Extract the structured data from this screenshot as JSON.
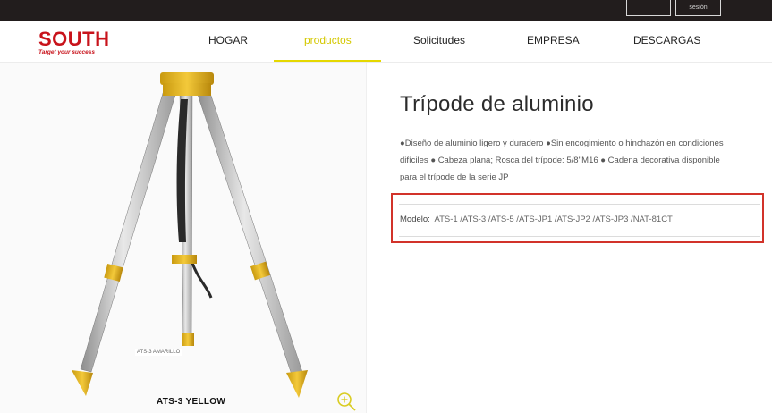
{
  "header": {
    "account_label": "sesión"
  },
  "logo": {
    "brand": "SOUTH",
    "tagline": "Target your success"
  },
  "nav": {
    "items": [
      {
        "label": "HOGAR"
      },
      {
        "label": "productos"
      },
      {
        "label": "Solicitudes"
      },
      {
        "label": "EMPRESA"
      },
      {
        "label": "DESCARGAS"
      }
    ],
    "active_index": 1,
    "accent_color": "#e5d800"
  },
  "product": {
    "title": "Trípode de aluminio",
    "description": "●Diseño de aluminio ligero y duradero ●Sin encogimiento o hinchazón en condiciones difíciles ● Cabeza plana; Rosca del trípode: 5/8''M16 ● Cadena decorativa disponible para el trípode de la serie JP",
    "model_label": "Modelo:",
    "model_value": "ATS-1 /ATS-3 /ATS-5 /ATS-JP1 /ATS-JP2 /ATS-JP3 /NAT-81CT",
    "image_caption": "ATS-3 YELLOW",
    "image_small_label": "ATS-3 AMARILLO",
    "highlight_color": "#d2332a"
  },
  "icons": {
    "zoom": "zoom-in-icon"
  }
}
